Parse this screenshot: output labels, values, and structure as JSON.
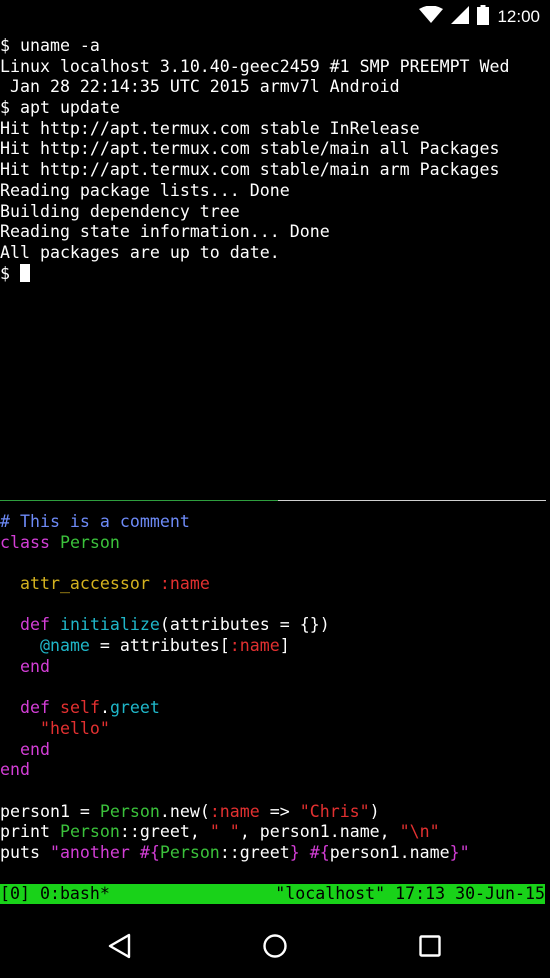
{
  "status_bar": {
    "time": "12:00",
    "icons": [
      "wifi-icon",
      "signal-icon",
      "battery-icon"
    ]
  },
  "terminal_top": {
    "lines": [
      "$ uname -a",
      "Linux localhost 3.10.40-geec2459 #1 SMP PREEMPT Wed",
      " Jan 28 22:14:35 UTC 2015 armv7l Android",
      "$ apt update",
      "Hit http://apt.termux.com stable InRelease",
      "Hit http://apt.termux.com stable/main all Packages",
      "Hit http://apt.termux.com stable/main arm Packages",
      "Reading package lists... Done",
      "Building dependency tree",
      "Reading state information... Done",
      "All packages are up to date."
    ],
    "prompt": "$ "
  },
  "code": {
    "comment": "# This is a comment",
    "class_kw": "class",
    "class_name": "Person",
    "attr_accessor": "attr_accessor",
    "sym_name": ":name",
    "def_kw": "def",
    "initialize": "initialize",
    "init_args": "(attributes = {})",
    "ivar_name": "@name",
    "assign_attrs": " = attributes[",
    "close_bracket": "]",
    "end_kw": "end",
    "self_kw": "self",
    "dot": ".",
    "greet": "greet",
    "hello_str": "\"hello\"",
    "person1_assign": "person1 = ",
    "new_call": ".new(",
    "rocket": " => ",
    "chris_str": "\"Chris\"",
    "close_paren": ")",
    "print_kw": "print ",
    "scope_greet": "::greet, ",
    "space_str": "\" \"",
    "name_call": ", person1.name, ",
    "newline_str": "\"\\n\"",
    "puts_kw": "puts ",
    "interp_open": "\"another #{",
    "interp_mid_person": "Person",
    "interp_greet": "::greet",
    "interp_close1": "} #{",
    "interp_person1_name": "person1.name",
    "interp_close2": "}\""
  },
  "tmux_status": {
    "left": "[0] 0:bash*",
    "right": "\"localhost\" 17:13 30-Jun-15"
  },
  "nav_bar": {
    "buttons": [
      "back-button",
      "home-button",
      "recents-button"
    ]
  },
  "colors": {
    "background": "#000000",
    "tmux_bar": "#19d219",
    "divider_active": "#2e9e3e",
    "comment": "#6d8af6",
    "keyword": "#d33ed6",
    "constant": "#3bc23b",
    "symbol": "#e23030",
    "method": "#1fb6c8",
    "accessor": "#d4b21f"
  }
}
